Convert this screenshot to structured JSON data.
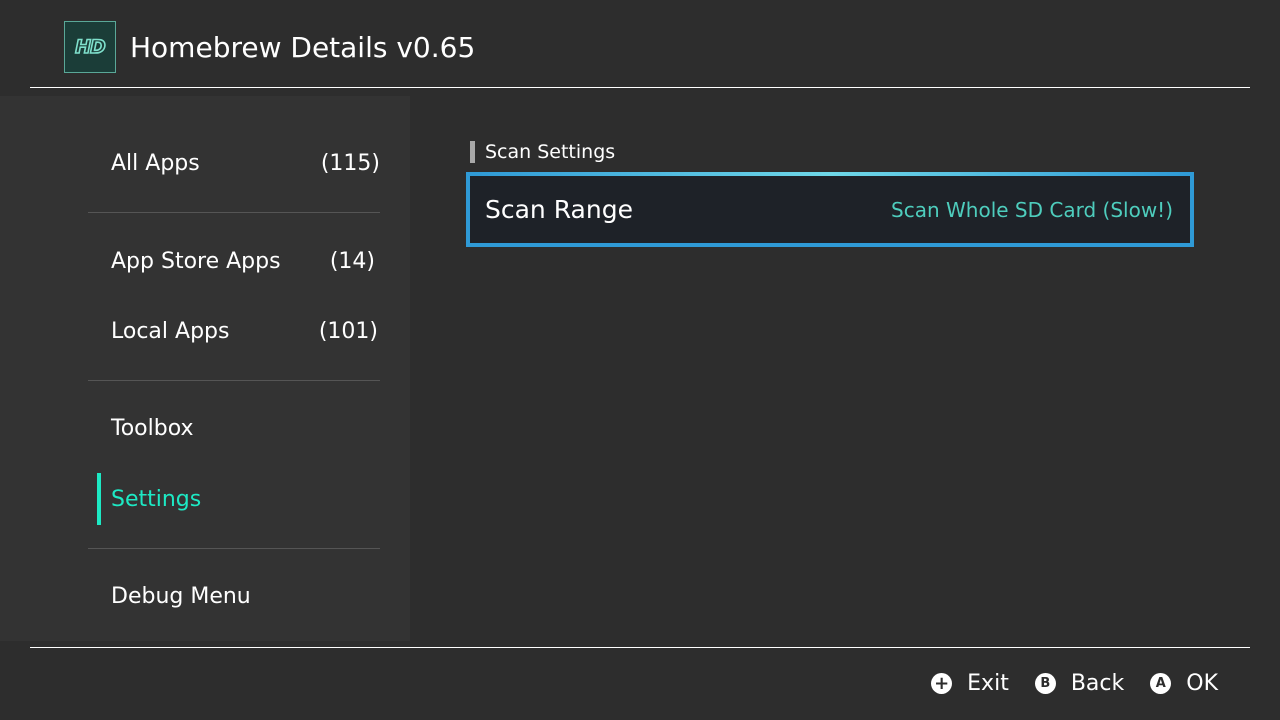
{
  "app": {
    "icon_text": "HD",
    "title": "Homebrew Details v0.65"
  },
  "sidebar": {
    "items": [
      {
        "label": "All Apps",
        "count": "(115)"
      },
      {
        "label": "App Store Apps",
        "count": "(14)"
      },
      {
        "label": "Local Apps",
        "count": "(101)"
      },
      {
        "label": "Toolbox"
      },
      {
        "label": "Settings",
        "selected": true
      },
      {
        "label": "Debug Menu"
      }
    ]
  },
  "content": {
    "section_title": "Scan Settings",
    "items": [
      {
        "label": "Scan Range",
        "value": "Scan Whole SD Card (Slow!)"
      }
    ]
  },
  "footer": {
    "hints": [
      {
        "button": "+",
        "label": "Exit"
      },
      {
        "button": "B",
        "label": "Back"
      },
      {
        "button": "A",
        "label": "OK"
      }
    ]
  },
  "colors": {
    "background": "#2d2d2d",
    "sidebar": "#333333",
    "accent": "#1de9c4",
    "focus_border": "#2f9ad6",
    "value_text": "#4ecdbd"
  }
}
